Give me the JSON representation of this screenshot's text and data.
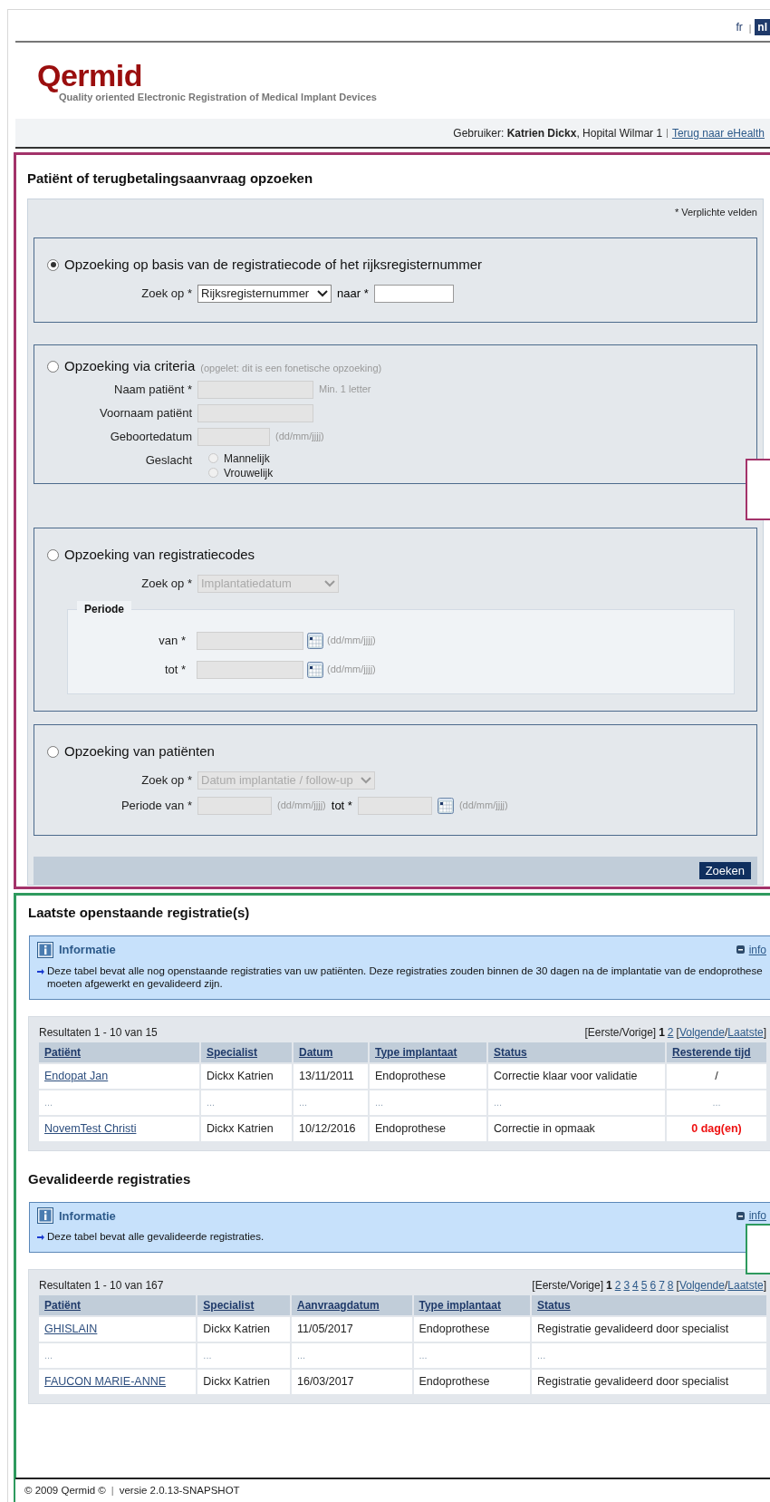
{
  "lang_switch": [
    {
      "label": "fr",
      "selected": false
    },
    {
      "label": "nl",
      "selected": true
    }
  ],
  "lang_separator": "|",
  "logo": {
    "name": "Qermid",
    "tagline": "Quality oriented Electronic Registration of Medical Implant Devices"
  },
  "user_bar": {
    "label": "Gebruiker:",
    "user": "Katrien Dickx",
    "organisation": ", Hopital Wilmar 1",
    "separator": "|",
    "link": "Terug naar eHealth"
  },
  "search": {
    "title": "Patiënt of terugbetalingsaanvraag opzoeken",
    "required_note": "* Verplichte velden",
    "button": "Zoeken",
    "options": [
      {
        "kind": "code",
        "selected": true,
        "label": "Opzoeking op basis van de registratiecode of het rijksregisternummer",
        "search_label": "Zoek op *",
        "select": "Rijksregisternummer",
        "to_label": "naar *"
      },
      {
        "kind": "criteria",
        "selected": false,
        "label": "Opzoeking via criteria",
        "hint": "(opgelet: dit is een fonetische opzoeking)",
        "fields": [
          {
            "label": "Naam patiënt *",
            "hint": "Min. 1 letter"
          },
          {
            "label": "Voornaam patiënt"
          },
          {
            "label": "Geboortedatum",
            "hint": "(dd/mm/jjjj)"
          }
        ],
        "gender_label": "Geslacht",
        "genders": [
          {
            "label": "Mannelijk",
            "selected": false
          },
          {
            "label": "Vrouwelijk",
            "selected": false
          }
        ]
      },
      {
        "kind": "codes",
        "selected": false,
        "label": "Opzoeking van registratiecodes",
        "search_label": "Zoek op *",
        "select": "Implantatiedatum",
        "period_title": "Periode",
        "period": [
          {
            "label": "van *",
            "hint": "(dd/mm/jjjj)"
          },
          {
            "label": "tot *",
            "hint": "(dd/mm/jjjj)"
          }
        ]
      },
      {
        "kind": "patients",
        "selected": false,
        "label": "Opzoeking van patiënten",
        "search_label": "Zoek op *",
        "select": "Datum implantatie / follow-up",
        "from_label": "Periode van *",
        "from_hint": "(dd/mm/jjjj)",
        "to_label": "tot *",
        "to_hint": "(dd/mm/jjjj)"
      }
    ]
  },
  "tables": [
    {
      "title": "Laatste openstaande registratie(s)",
      "info": {
        "title": "Informatie",
        "toggle": "info",
        "text": "Deze tabel bevat alle nog openstaande registraties van uw patiënten. Deze registraties zouden binnen de 30 dagen na de implantatie van de endoprothese moeten afgewerkt en gevalideerd zijn."
      },
      "results": "Resultaten 1 - 10 van 15",
      "pager": {
        "prefix": "[Eerste/Vorige]",
        "pages": [
          {
            "label": "1",
            "selected": true
          },
          {
            "label": "2",
            "selected": false
          }
        ],
        "open": "[",
        "next": "Volgende",
        "sep": "/",
        "last": "Laatste",
        "close": "]"
      },
      "columns": [
        "Patiënt",
        "Specialist",
        "Datum",
        "Type implantaat",
        "Status",
        "Resterende tijd"
      ],
      "rows": [
        {
          "kind": "data",
          "urgent": false,
          "cells": [
            "Endopat Jan",
            "Dickx Katrien",
            "13/11/2011",
            "Endoprothese",
            "Correctie klaar voor validatie",
            "/"
          ]
        },
        {
          "kind": "gap",
          "urgent": false,
          "cells": [
            "...",
            "...",
            "...",
            "...",
            "...",
            "..."
          ]
        },
        {
          "kind": "data",
          "urgent": true,
          "cells": [
            "NovemTest Christi",
            "Dickx Katrien",
            "10/12/2016",
            "Endoprothese",
            "Correctie in opmaak",
            "0 dag(en)"
          ]
        }
      ]
    },
    {
      "title": "Gevalideerde registraties",
      "info": {
        "title": "Informatie",
        "toggle": "info",
        "text": "Deze tabel bevat alle gevalideerde registraties."
      },
      "results": "Resultaten 1 - 10 van 167",
      "pager": {
        "prefix": "[Eerste/Vorige]",
        "pages": [
          {
            "label": "1",
            "selected": true
          },
          {
            "label": "2",
            "selected": false
          },
          {
            "label": "3",
            "selected": false
          },
          {
            "label": "4",
            "selected": false
          },
          {
            "label": "5",
            "selected": false
          },
          {
            "label": "6",
            "selected": false
          },
          {
            "label": "7",
            "selected": false
          },
          {
            "label": "8",
            "selected": false
          }
        ],
        "open": "[",
        "next": "Volgende",
        "sep": "/",
        "last": "Laatste",
        "close": "]"
      },
      "columns": [
        "Patiënt",
        "Specialist",
        "Aanvraagdatum",
        "Type implantaat",
        "Status"
      ],
      "rows": [
        {
          "kind": "data",
          "cells": [
            "GHISLAIN",
            "Dickx Katrien",
            "11/05/2017",
            "Endoprothese",
            "Registratie gevalideerd door specialist"
          ]
        },
        {
          "kind": "gap",
          "cells": [
            "...",
            "...",
            "...",
            "...",
            "..."
          ]
        },
        {
          "kind": "data",
          "cells": [
            "FAUCON MARIE-ANNE",
            "Dickx Katrien",
            "16/03/2017",
            "Endoprothese",
            "Registratie gevalideerd door specialist"
          ]
        }
      ]
    }
  ],
  "footer": {
    "copyright": "© 2009 Qermid ©",
    "separator": "|",
    "version": "versie 2.0.13-SNAPSHOT"
  }
}
